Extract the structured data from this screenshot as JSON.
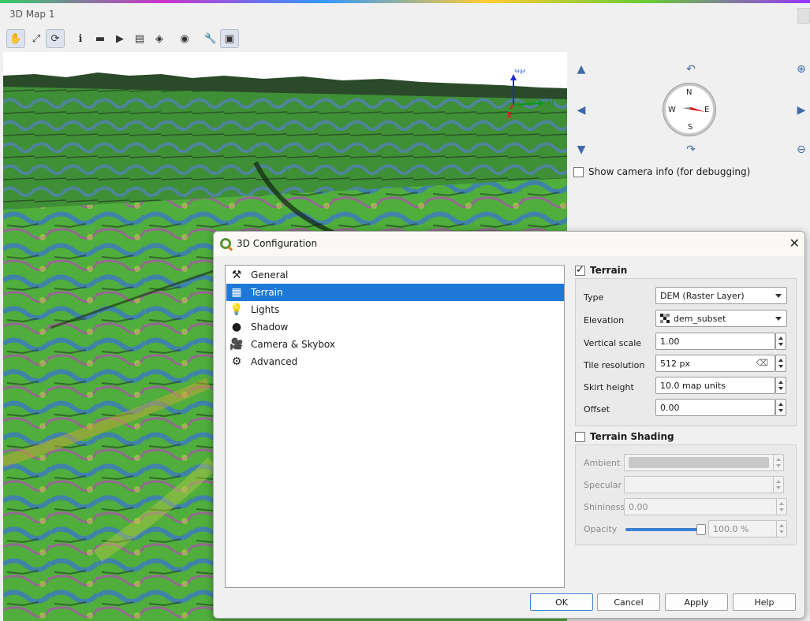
{
  "window": {
    "title": "3D Map 1"
  },
  "toolbar": {
    "items": [
      {
        "name": "pan-icon",
        "glyph": "✋",
        "active": true
      },
      {
        "name": "zoom-full-icon",
        "glyph": "⤢",
        "active": false
      },
      {
        "name": "rotate-icon",
        "glyph": "⟳",
        "active": true
      },
      {
        "name": "identify-icon",
        "glyph": "ℹ",
        "active": false
      },
      {
        "name": "measure-icon",
        "glyph": "▬",
        "active": false
      },
      {
        "name": "animation-icon",
        "glyph": "▶",
        "active": false
      },
      {
        "name": "save-image-icon",
        "glyph": "▤",
        "active": false
      },
      {
        "name": "export-scene-icon",
        "glyph": "◈",
        "active": false
      },
      {
        "name": "camera-view-icon",
        "glyph": "◉",
        "active": false
      },
      {
        "name": "configure-icon",
        "glyph": "🔧",
        "active": false
      },
      {
        "name": "dock-icon",
        "glyph": "▣",
        "active": true
      }
    ]
  },
  "axes": {
    "up": "up",
    "north": "N",
    "east": "E"
  },
  "navigation": {
    "compass": {
      "n": "N",
      "s": "S",
      "e": "E",
      "w": "W"
    },
    "camera_info_label": "Show camera info (for debugging)",
    "camera_info_checked": false
  },
  "dialog": {
    "title": "3D Configuration",
    "close_glyph": "✕",
    "sections": [
      {
        "label": "General",
        "icon": "general-icon",
        "glyph": "⚒",
        "selected": false
      },
      {
        "label": "Terrain",
        "icon": "terrain-icon",
        "glyph": "▦",
        "selected": true
      },
      {
        "label": "Lights",
        "icon": "lights-icon",
        "glyph": "💡",
        "selected": false
      },
      {
        "label": "Shadow",
        "icon": "shadow-icon",
        "glyph": "●",
        "selected": false
      },
      {
        "label": "Camera & Skybox",
        "icon": "camera-icon",
        "glyph": "🎥",
        "selected": false
      },
      {
        "label": "Advanced",
        "icon": "advanced-icon",
        "glyph": "⚙",
        "selected": false
      }
    ],
    "terrain": {
      "header": "Terrain",
      "enabled": true,
      "type_label": "Type",
      "type_value": "DEM (Raster Layer)",
      "elevation_label": "Elevation",
      "elevation_value": "dem_subset",
      "vscale_label": "Vertical scale",
      "vscale_value": "1.00",
      "tileres_label": "Tile resolution",
      "tileres_value": "512 px",
      "skirt_label": "Skirt height",
      "skirt_value": "10.0 map units",
      "offset_label": "Offset",
      "offset_value": "0.00"
    },
    "shading": {
      "header": "Terrain Shading",
      "enabled": false,
      "ambient_label": "Ambient",
      "specular_label": "Specular",
      "shininess_label": "Shininess",
      "shininess_value": "0.00",
      "opacity_label": "Opacity",
      "opacity_value": "100.0 %",
      "opacity_fraction": 1.0,
      "ambient_color": "#c8c8c8"
    },
    "buttons": {
      "ok": "OK",
      "cancel": "Cancel",
      "apply": "Apply",
      "help": "Help"
    }
  }
}
